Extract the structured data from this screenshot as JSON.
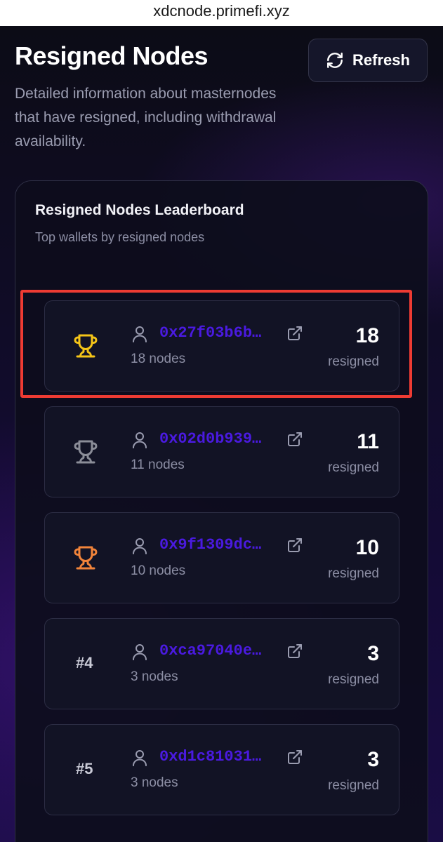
{
  "browser": {
    "url": "xdcnode.primefi.xyz"
  },
  "header": {
    "title": "Resigned Nodes",
    "refresh_label": "Refresh",
    "description": "Detailed information about masternodes that have resigned, including withdrawal availability."
  },
  "leaderboard": {
    "title": "Resigned Nodes Leaderboard",
    "subtitle": "Top wallets by resigned nodes",
    "resigned_label": "resigned",
    "entries": [
      {
        "rank": "1",
        "rank_icon": "trophy-gold-icon",
        "address": "0x27f03b6b…",
        "nodes": "18 nodes",
        "count": "18"
      },
      {
        "rank": "2",
        "rank_icon": "trophy-silver-icon",
        "address": "0x02d0b939…",
        "nodes": "11 nodes",
        "count": "11"
      },
      {
        "rank": "3",
        "rank_icon": "trophy-bronze-icon",
        "address": "0x9f1309dc…",
        "nodes": "10 nodes",
        "count": "10"
      },
      {
        "rank": "#4",
        "address": "0xca97040e…",
        "nodes": "3 nodes",
        "count": "3"
      },
      {
        "rank": "#5",
        "address": "0xd1c81031…",
        "nodes": "3 nodes",
        "count": "3"
      }
    ]
  },
  "colors": {
    "gold": "#f5c518",
    "silver": "#8b8d98",
    "bronze": "#f2843a",
    "address": "#4a1ae0",
    "highlight": "#ee3b33"
  }
}
